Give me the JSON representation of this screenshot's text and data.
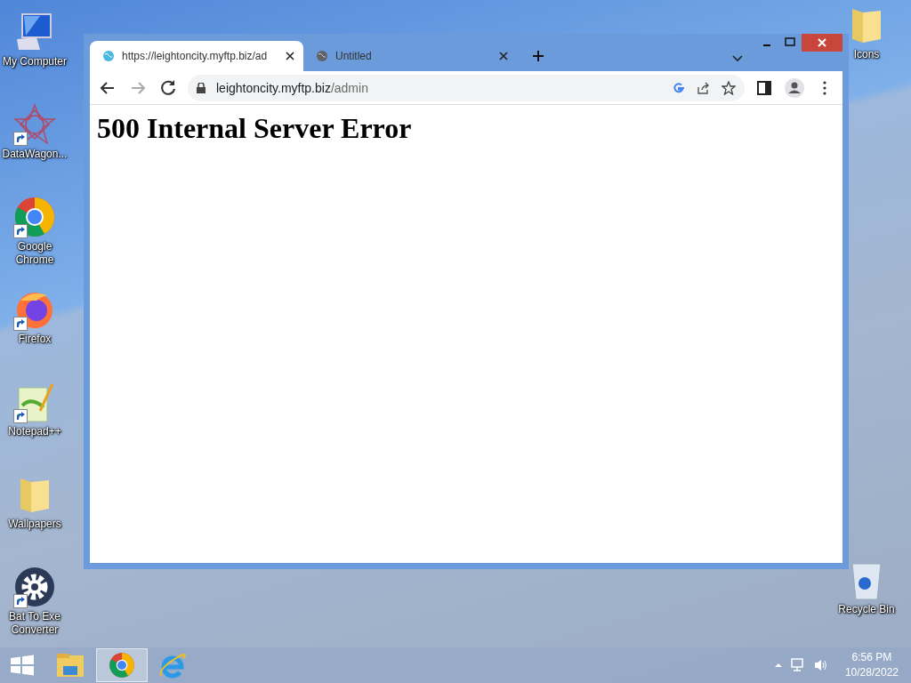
{
  "desktop": {
    "left_icons": [
      {
        "label": "My Computer",
        "kind": "computer",
        "shortcut": false
      },
      {
        "label": "DataWagon...",
        "kind": "star",
        "shortcut": true
      },
      {
        "label": "Google Chrome",
        "kind": "chrome",
        "shortcut": true
      },
      {
        "label": "Firefox",
        "kind": "firefox",
        "shortcut": true
      },
      {
        "label": "Notepad++",
        "kind": "notepad",
        "shortcut": true
      },
      {
        "label": "Wallpapers",
        "kind": "folder",
        "shortcut": false
      },
      {
        "label": "Bat To Exe Converter",
        "kind": "gear",
        "shortcut": true
      }
    ],
    "right_icons": [
      {
        "label": "Icons",
        "kind": "folder",
        "shortcut": false
      },
      {
        "label": "Recycle Bin",
        "kind": "bin",
        "shortcut": false
      }
    ]
  },
  "browser": {
    "tabs": [
      {
        "title": "https://leightoncity.myftp.biz/ad",
        "selected": true
      },
      {
        "title": "Untitled",
        "selected": false
      }
    ],
    "address": {
      "host": "leightoncity.myftp.biz",
      "path": "/admin"
    },
    "page": {
      "heading": "500 Internal Server Error"
    }
  },
  "taskbar": {
    "apps": [
      {
        "kind": "explorer",
        "selected": false
      },
      {
        "kind": "chrome",
        "selected": true
      },
      {
        "kind": "ie",
        "selected": false
      }
    ],
    "clock": {
      "time": "6:56 PM",
      "date": "10/28/2022"
    }
  }
}
